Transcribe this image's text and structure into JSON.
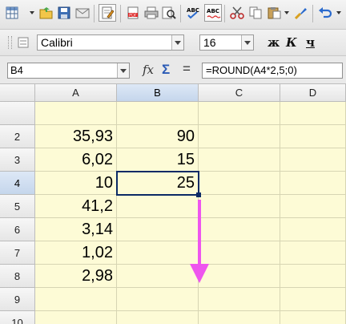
{
  "toolbar": {
    "icons": [
      "table-icon",
      "open-folder-icon",
      "save-icon",
      "email-icon",
      "edit-document-icon",
      "export-pdf-icon",
      "print-icon",
      "print-preview-icon",
      "spellcheck-icon",
      "autospellcheck-icon",
      "cut-icon",
      "copy-icon",
      "paste-icon",
      "format-paintbrush-icon",
      "undo-icon"
    ],
    "spell_label": "ABC",
    "auto_spell_label": "ABC"
  },
  "format_bar": {
    "font_name": "Calibri",
    "font_size": "16",
    "bold_label": "ж",
    "italic_label": "К",
    "underline_label": "ч"
  },
  "formula_bar": {
    "cell_ref": "B4",
    "fx_label": "fx",
    "sum_label": "Σ",
    "equals_label": "=",
    "formula": "=ROUND(A4*2,5;0)"
  },
  "sheet": {
    "columns": [
      "A",
      "B",
      "C",
      "D"
    ],
    "rows": [
      "2",
      "3",
      "4",
      "5",
      "6",
      "7",
      "8",
      "9",
      "10"
    ],
    "selected_cell": "B4",
    "cells": {
      "A2": "35,93",
      "A3": "6,02",
      "A4": "10",
      "A5": "41,2",
      "A6": "3,14",
      "A7": "1,02",
      "A8": "2,98",
      "B2": "90",
      "B3": "15",
      "B4": "25"
    },
    "annotation": {
      "type": "arrow",
      "color": "#ee55ee",
      "direction": "down"
    }
  }
}
